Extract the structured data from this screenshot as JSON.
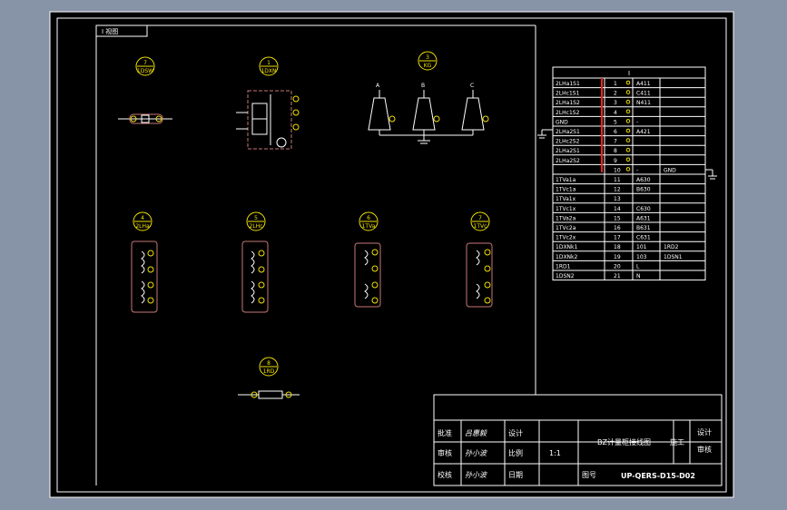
{
  "tab_label": "I 视图",
  "colors": {
    "background": "#8793a6",
    "sheet": "#000000",
    "line": "#ffffff",
    "device": "#c87878",
    "highlight": "#ff2020",
    "badge": "#f2e000"
  },
  "devices": [
    {
      "num": "7",
      "code": "1DSW"
    },
    {
      "num": "1",
      "code": "1DXN"
    },
    {
      "num": "3",
      "code": "KG"
    },
    {
      "num": "4",
      "code": "2LHa"
    },
    {
      "num": "5",
      "code": "2LHc"
    },
    {
      "num": "6",
      "code": "1TVa"
    },
    {
      "num": "7",
      "code": "1TVc"
    },
    {
      "num": "8",
      "code": "1RD"
    }
  ],
  "kg_phases": [
    "A",
    "B",
    "C"
  ],
  "terminal_table": {
    "header": "I",
    "rows": [
      [
        "2LHa1S1",
        "1",
        "A411",
        ""
      ],
      [
        "2LHc1S1",
        "2",
        "C411",
        ""
      ],
      [
        "2LHa1S2",
        "3",
        "N411",
        ""
      ],
      [
        "2LHc1S2",
        "4",
        "",
        ""
      ],
      [
        "GND",
        "5",
        "-",
        ""
      ],
      [
        "2LHa2S1",
        "6",
        "A421",
        ""
      ],
      [
        "2LHc2S2",
        "7",
        "",
        ""
      ],
      [
        "2LHa2S1",
        "8",
        "",
        ""
      ],
      [
        "2LHa2S2",
        "9",
        "",
        ""
      ],
      [
        "",
        "10",
        "-",
        "GND"
      ],
      [
        "1TVa1a",
        "11",
        "A630",
        ""
      ],
      [
        "1TVc1a",
        "12",
        "B630",
        ""
      ],
      [
        "1TVa1x",
        "13",
        "",
        ""
      ],
      [
        "1TVc1x",
        "14",
        "C630",
        ""
      ],
      [
        "1TVa2a",
        "15",
        "A631",
        ""
      ],
      [
        "1TVc2a",
        "16",
        "B631",
        ""
      ],
      [
        "1TVc2x",
        "17",
        "C631",
        ""
      ],
      [
        "1DXNk1",
        "18",
        "101",
        "1RD2"
      ],
      [
        "1DXNk2",
        "19",
        "103",
        "1DSN1"
      ],
      [
        "1RD1",
        "20",
        "L",
        ""
      ],
      [
        "1DSN2",
        "21",
        "N",
        ""
      ]
    ]
  },
  "title_block": {
    "title": "BZ计量柜接线图",
    "drawing_no_label": "图号",
    "drawing_no": "UP-QERS-D15-D02",
    "rows": [
      {
        "label": "批准",
        "signature": "吕惠毅",
        "col2": "设计"
      },
      {
        "label": "审核",
        "signature": "孙小波",
        "col2": "比例",
        "value": "1:1"
      },
      {
        "label": "校核",
        "signature": "孙小波",
        "col2": "日期"
      }
    ],
    "right_labels": [
      "设计",
      "施工",
      "审核"
    ]
  }
}
